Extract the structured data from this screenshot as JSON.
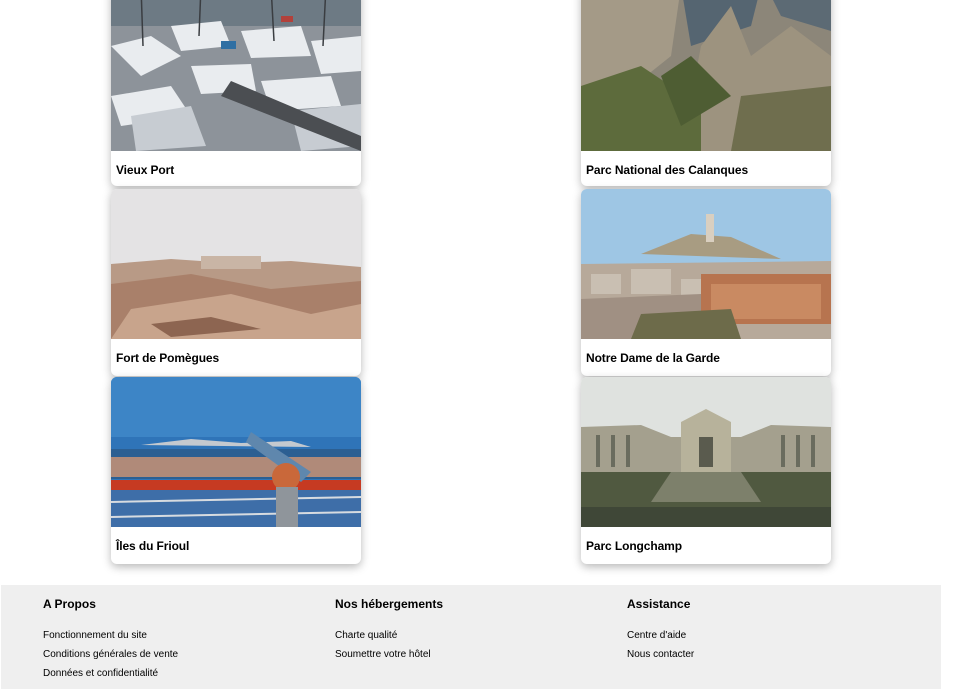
{
  "cards": [
    {
      "id": "vieux-port",
      "title": "Vieux Port"
    },
    {
      "id": "calanques",
      "title": "Parc National des Calanques"
    },
    {
      "id": "pomegues",
      "title": "Fort de Pomègues"
    },
    {
      "id": "notre-dame",
      "title": "Notre Dame de la Garde"
    },
    {
      "id": "frioul",
      "title": "Îles du Frioul"
    },
    {
      "id": "longchamp",
      "title": "Parc Longchamp"
    }
  ],
  "footer": {
    "columns": [
      {
        "heading": "A Propos",
        "links": [
          "Fonctionnement du site",
          "Conditions générales de vente",
          "Données et confidentialité"
        ]
      },
      {
        "heading": "Nos hébergements",
        "links": [
          "Charte qualité",
          "Soumettre votre hôtel"
        ]
      },
      {
        "heading": "Assistance",
        "links": [
          "Centre d'aide",
          "Nous contacter"
        ]
      }
    ]
  }
}
